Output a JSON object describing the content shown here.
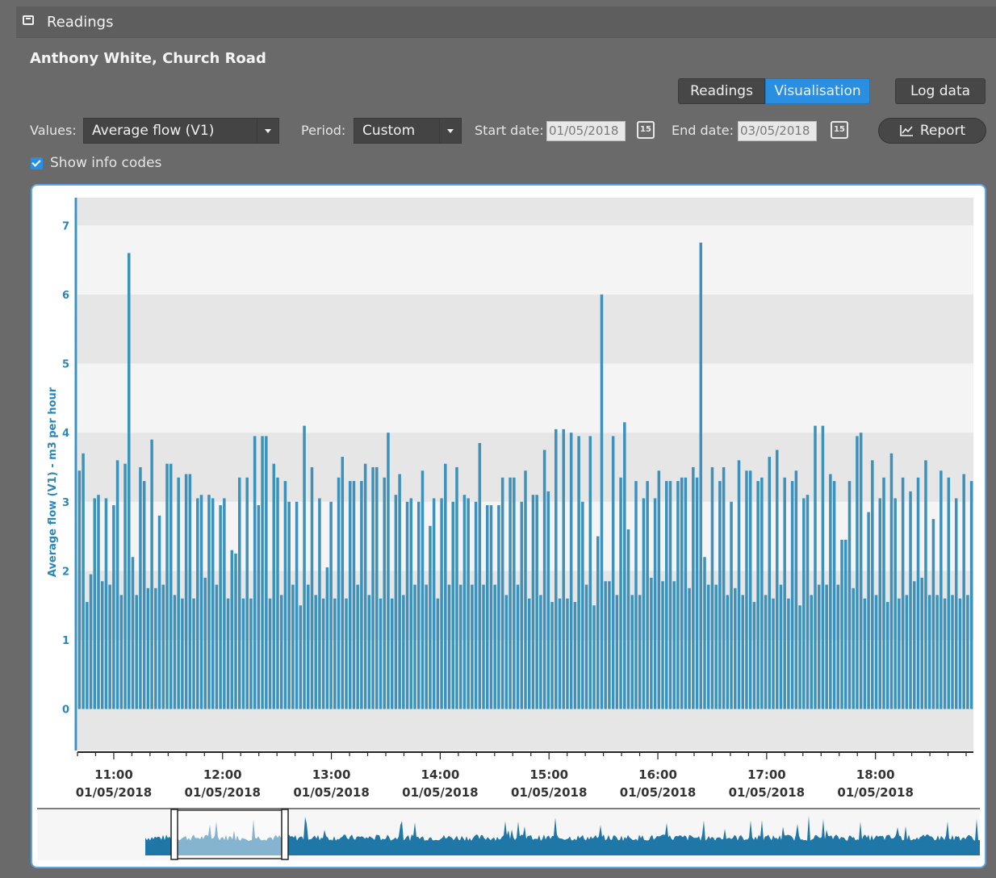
{
  "window": {
    "title": "Readings",
    "icon": "window-icon"
  },
  "header": {
    "subtitle": "Anthony White, Church Road"
  },
  "view_tabs": [
    {
      "label": "Readings",
      "selected": false
    },
    {
      "label": "Visualisation",
      "selected": true
    }
  ],
  "log_data_label": "Log data",
  "controls": {
    "values_label": "Values:",
    "values_selected": "Average flow (V1)",
    "period_label": "Period:",
    "period_selected": "Custom",
    "start_label": "Start date:",
    "start_value": "01/05/2018",
    "end_label": "End date:",
    "end_value": "03/05/2018",
    "calendar_glyph": "15",
    "report_label": "Report"
  },
  "show_info_codes": {
    "label": "Show info codes",
    "checked": true
  },
  "colors": {
    "accent": "#2a8fe0",
    "bar": "#3d92bb",
    "axis_text": "#2b86b8"
  },
  "chart_data": {
    "type": "bar",
    "ylabel": "Average flow (V1) - m3 per hour",
    "ylim": [
      -0.6,
      7.4
    ],
    "yticks": [
      0,
      1,
      2,
      3,
      4,
      5,
      6,
      7
    ],
    "grid": "horizontal bands",
    "x_ticks": [
      {
        "time": "11:00",
        "date": "01/05/2018"
      },
      {
        "time": "12:00",
        "date": "01/05/2018"
      },
      {
        "time": "13:00",
        "date": "01/05/2018"
      },
      {
        "time": "14:00",
        "date": "01/05/2018"
      },
      {
        "time": "15:00",
        "date": "01/05/2018"
      },
      {
        "time": "16:00",
        "date": "01/05/2018"
      },
      {
        "time": "17:00",
        "date": "01/05/2018"
      },
      {
        "time": "18:00",
        "date": "01/05/2018"
      }
    ],
    "x_start": "01/05/2018 10:40",
    "x_end": "01/05/2018 18:54",
    "values": [
      3.45,
      3.7,
      1.55,
      1.95,
      3.05,
      3.1,
      1.85,
      3.05,
      1.8,
      2.95,
      3.6,
      1.65,
      3.55,
      6.6,
      2.2,
      1.65,
      3.5,
      3.3,
      1.75,
      3.9,
      1.75,
      2.8,
      1.8,
      3.55,
      3.55,
      1.65,
      3.35,
      1.6,
      3.4,
      3.4,
      1.6,
      3.05,
      3.1,
      1.9,
      3.1,
      3.05,
      1.8,
      2.95,
      3.05,
      1.6,
      2.3,
      2.25,
      3.35,
      1.6,
      3.35,
      1.6,
      3.95,
      2.95,
      3.95,
      3.95,
      1.6,
      3.55,
      3.35,
      1.65,
      3.3,
      3,
      1.8,
      3,
      1.5,
      4.1,
      1.8,
      3.5,
      1.65,
      3.05,
      1.6,
      2.05,
      3,
      1.6,
      3.35,
      3.65,
      1.6,
      3.3,
      3.3,
      1.8,
      3.3,
      3.55,
      1.65,
      3.5,
      3.5,
      1.6,
      3.35,
      4,
      1.6,
      3.1,
      3.4,
      1.65,
      3,
      3.05,
      1.8,
      3,
      3.45,
      1.8,
      2.65,
      3.05,
      1.6,
      3.05,
      3.55,
      1.8,
      3,
      3.5,
      1.8,
      3.1,
      3.05,
      1.8,
      3,
      3.85,
      1.8,
      2.95,
      2.95,
      1.8,
      2.95,
      3.35,
      1.65,
      3.35,
      3.35,
      1.8,
      3,
      3.45,
      1.6,
      3.1,
      3.1,
      1.65,
      3.75,
      3.15,
      1.55,
      4.05,
      1.6,
      4.05,
      1.6,
      4,
      1.55,
      3.95,
      3,
      1.8,
      3.95,
      1.5,
      2.5,
      6,
      1.85,
      1.85,
      3.95,
      1.65,
      3.35,
      4.15,
      2.6,
      1.65,
      3.3,
      1.65,
      3.05,
      3.3,
      1.9,
      3.05,
      3.45,
      1.85,
      3.3,
      3.3,
      1.85,
      3.3,
      3.35,
      3.35,
      1.75,
      3.5,
      3.35,
      6.75,
      2.2,
      1.8,
      3.5,
      1.8,
      3.3,
      3.5,
      1.65,
      3,
      1.75,
      3.6,
      1.65,
      3.45,
      3.45,
      1.55,
      3.3,
      3.35,
      1.65,
      3.65,
      1.6,
      3.75,
      1.8,
      3.35,
      1.6,
      3.3,
      3.45,
      1.5,
      3.05,
      3.1,
      1.65,
      4.1,
      1.8,
      4.1,
      1.8,
      3.4,
      3.3,
      1.8,
      2.45,
      2.45,
      3.3,
      1.75,
      3.95,
      4,
      1.6,
      2.85,
      3.6,
      1.65,
      3.05,
      3.35,
      1.55,
      3.7,
      3.05,
      1.6,
      3.35,
      1.65,
      3.15,
      1.85,
      3.35,
      1.9,
      3.6,
      1.65,
      2.75,
      1.65,
      3.45,
      1.6,
      3.35,
      1.65,
      3.05,
      1.6,
      3.4,
      1.65,
      3.3
    ],
    "navigator": {
      "window_start": "01/05/2018 10:40",
      "window_end": "01/05/2018 18:54"
    }
  }
}
